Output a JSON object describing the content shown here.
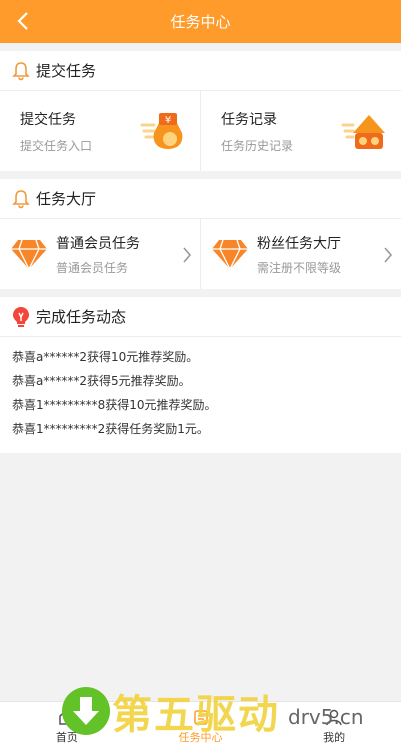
{
  "header": {
    "title": "任务中心"
  },
  "submit_section": {
    "title": "提交任务",
    "items": [
      {
        "title": "提交任务",
        "subtitle": "提交任务入口",
        "icon": "money-bag-icon"
      },
      {
        "title": "任务记录",
        "subtitle": "任务历史记录",
        "icon": "task-history-icon"
      }
    ]
  },
  "hall_section": {
    "title": "任务大厅",
    "items": [
      {
        "title": "普通会员任务",
        "subtitle": "普通会员任务",
        "icon": "diamond-icon"
      },
      {
        "title": "粉丝任务大厅",
        "subtitle": "需注册不限等级",
        "icon": "diamond-icon"
      }
    ]
  },
  "dynamic_section": {
    "title": "完成任务动态",
    "rows": [
      "恭喜a******2获得10元推荐奖励。",
      "恭喜a******2获得5元推荐奖励。",
      "恭喜1*********8获得10元推荐奖励。",
      "恭喜1*********2获得任务奖励1元。"
    ]
  },
  "tabbar": {
    "tabs": [
      {
        "label": "首页"
      },
      {
        "label": "任务中心",
        "active": true
      },
      {
        "label": "我的"
      }
    ]
  },
  "watermark": {
    "text": "第五驱动",
    "sub": "drv5.cn"
  },
  "colors": {
    "accent": "#ff9b2a",
    "diamond": "#f7862a"
  }
}
